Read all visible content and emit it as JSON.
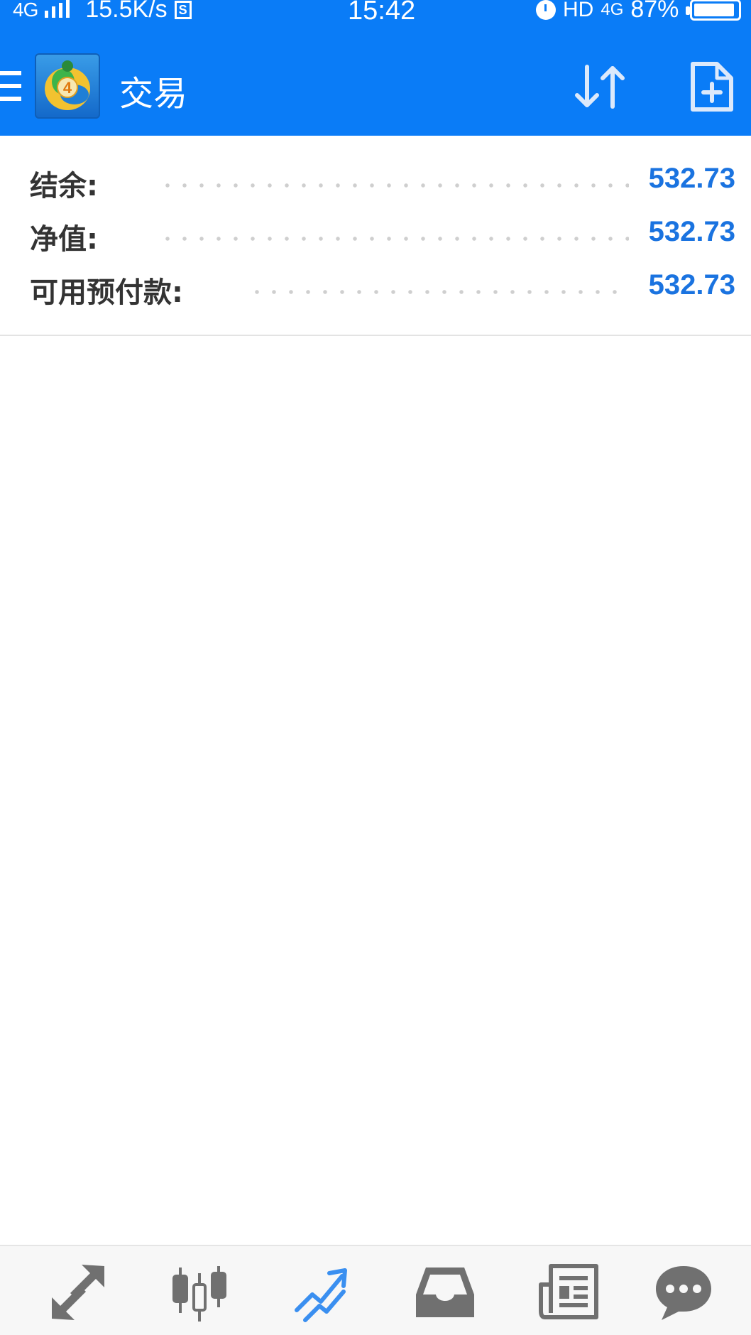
{
  "status_bar": {
    "network": "4G",
    "speed": "15.5K/s",
    "time": "15:42",
    "hd": "HD",
    "net_right": "4G",
    "battery": "87%"
  },
  "header": {
    "title": "交易"
  },
  "summary": {
    "rows": [
      {
        "label": "结余:",
        "value": "532.73"
      },
      {
        "label": "净值:",
        "value": "532.73"
      },
      {
        "label": "可用预付款:",
        "value": "532.73"
      }
    ]
  },
  "colors": {
    "header_bg": "#0a7cf7",
    "value_blue": "#1a73e0",
    "active_tab": "#3a8ff0",
    "inactive_tab": "#707070"
  },
  "bottom_nav": {
    "tabs": [
      {
        "icon": "quotes-arrows-icon",
        "active": false
      },
      {
        "icon": "chart-candles-icon",
        "active": false
      },
      {
        "icon": "trade-icon",
        "active": true
      },
      {
        "icon": "history-inbox-icon",
        "active": false
      },
      {
        "icon": "news-icon",
        "active": false
      },
      {
        "icon": "messages-icon",
        "active": false
      }
    ]
  }
}
